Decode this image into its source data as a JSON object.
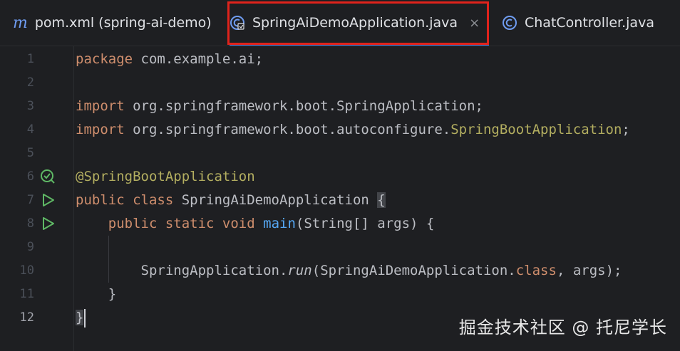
{
  "tabs": [
    {
      "label": "pom.xml (spring-ai-demo)",
      "icon": "maven-m-icon"
    },
    {
      "label": "SpringAiDemoApplication.java",
      "icon": "java-class-icon",
      "active": true,
      "close": "×"
    },
    {
      "label": "ChatController.java",
      "icon": "java-class-icon"
    }
  ],
  "pom_icon_letter": "m",
  "line_numbers": [
    "1",
    "2",
    "3",
    "4",
    "5",
    "6",
    "7",
    "8",
    "9",
    "10",
    "11",
    "12"
  ],
  "code": {
    "l1_kw": "package",
    "l1_rest": " com.example.ai;",
    "l3_kw": "import",
    "l3_rest": " org.springframework.boot.SpringApplication;",
    "l4_kw": "import",
    "l4_rest": " org.springframework.boot.autoconfigure.",
    "l4_ann": "SpringBootApplication",
    "l4_end": ";",
    "l6_ann": "@SpringBootApplication",
    "l7_kw": "public class",
    "l7_rest": " SpringAiDemoApplication ",
    "l7_brace": "{",
    "l8_indent": "    ",
    "l8_kw": "public static void",
    "l8_sp": " ",
    "l8_fn": "main",
    "l8_rest": "(String[] args) {",
    "l10_indent": "        ",
    "l10_a": "SpringApplication.",
    "l10_fn": "run",
    "l10_b": "(SpringAiDemoApplication.",
    "l10_kw": "class",
    "l10_c": ", args);",
    "l11": "    }",
    "l12": "}"
  },
  "watermark": "掘金技术社区 @ 托尼学长",
  "colors": {
    "background": "#1e1f22",
    "keyword": "#cf8e6d",
    "annotation": "#b3ae60",
    "method": "#56a8f5",
    "text": "#bcbec4",
    "highlight_box": "#e0231c",
    "run_icon": "#5fb865"
  }
}
